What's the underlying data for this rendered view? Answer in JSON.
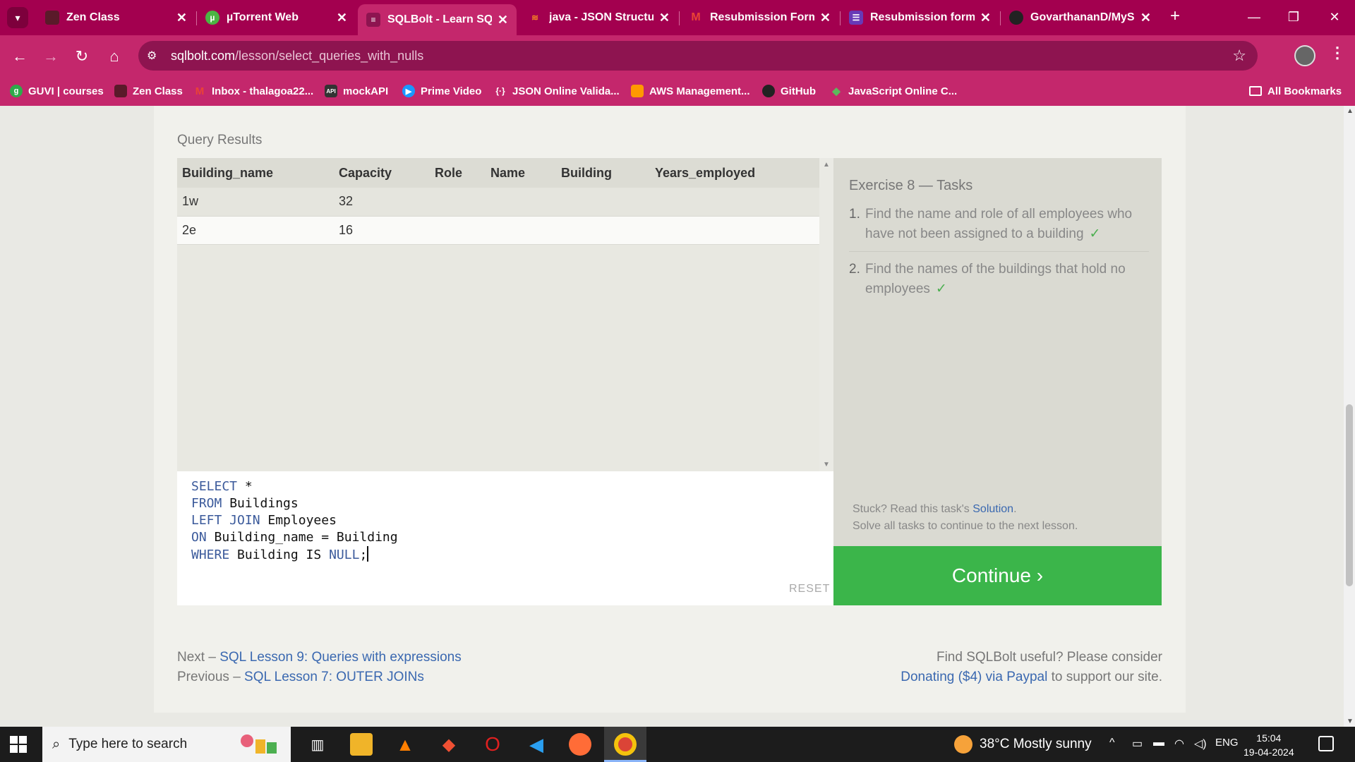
{
  "browser": {
    "tabs": [
      {
        "title": "Zen Class",
        "icon": "zen-class-icon",
        "color": "#5a1a2a"
      },
      {
        "title": "µTorrent Web",
        "icon": "utorrent-icon",
        "color": "#4bb543"
      },
      {
        "title": "SQLBolt - Learn SQL",
        "icon": "sqlbolt-icon",
        "color": "#c4276c"
      },
      {
        "title": "java - JSON Structur",
        "icon": "stackoverflow-icon",
        "color": "#f48024"
      },
      {
        "title": "Resubmission Form",
        "icon": "gmail-icon",
        "color": "#ea4335"
      },
      {
        "title": "Resubmission form",
        "icon": "google-forms-icon",
        "color": "#673ab7"
      },
      {
        "title": "GovarthananD/MySQ",
        "icon": "github-icon",
        "color": "#222222"
      }
    ],
    "url_host": "sqlbolt.com",
    "url_path": "/lesson/select_queries_with_nulls",
    "bookmarks": [
      {
        "label": "GUVI | courses",
        "icon": "guvi-icon",
        "color": "#2eaa4a"
      },
      {
        "label": "Zen Class",
        "icon": "zen-class-icon",
        "color": "#5a1a2a"
      },
      {
        "label": "Inbox - thalagoa22...",
        "icon": "gmail-icon",
        "color": "#ea4335"
      },
      {
        "label": "mockAPI",
        "icon": "mockapi-icon",
        "color": "#333333"
      },
      {
        "label": "Prime Video",
        "icon": "prime-video-icon",
        "color": "#1a98ff"
      },
      {
        "label": "JSON Online Valida...",
        "icon": "json-icon",
        "color": "#333333"
      },
      {
        "label": "AWS Management...",
        "icon": "aws-icon",
        "color": "#ff9900"
      },
      {
        "label": "GitHub",
        "icon": "github-icon",
        "color": "#222222"
      },
      {
        "label": "JavaScript Online C...",
        "icon": "js-compiler-icon",
        "color": "#5cb85c"
      }
    ],
    "all_bookmarks": "All Bookmarks"
  },
  "lesson": {
    "results_label": "Query Results",
    "columns": [
      "Building_name",
      "Capacity",
      "Role",
      "Name",
      "Building",
      "Years_employed"
    ],
    "rows": [
      [
        "1w",
        "32",
        "",
        "",
        "",
        ""
      ],
      [
        "2e",
        "16",
        "",
        "",
        "",
        ""
      ]
    ],
    "query_lines": [
      {
        "kw": "SELECT",
        "rest": " *",
        "kw2": "",
        "tail": ""
      },
      {
        "kw": "FROM",
        "rest": " Buildings",
        "kw2": "",
        "tail": ""
      },
      {
        "kw": "LEFT JOIN",
        "rest": " Employees",
        "kw2": "",
        "tail": ""
      },
      {
        "kw": "ON",
        "rest": " Building_name = Building",
        "kw2": "",
        "tail": ""
      },
      {
        "kw": "WHERE",
        "rest": " Building IS ",
        "kw2": "NULL",
        "tail": ";"
      }
    ],
    "reset_label": "RESET",
    "tasks_title": "Exercise 8 — Tasks",
    "tasks": [
      {
        "num": "1.",
        "text": "Find the name and role of all employees who have not been assigned to a building",
        "done": "✓"
      },
      {
        "num": "2.",
        "text": "Find the names of the buildings that hold no employees",
        "done": "✓"
      }
    ],
    "stuck_prefix": "Stuck? Read this task's ",
    "stuck_link": "Solution",
    "stuck_suffix": ".",
    "solve_all": "Solve all tasks to continue to the next lesson.",
    "continue_label": "Continue ›",
    "next_prefix": "Next – ",
    "next_link": "SQL Lesson 9: Queries with expressions",
    "prev_prefix": "Previous – ",
    "prev_link": "SQL Lesson 7: OUTER JOINs",
    "useful_text": "Find SQLBolt useful? Please consider",
    "donate_link": "Donating ($4) via Paypal",
    "donate_suffix": " to support our site."
  },
  "taskbar": {
    "search_placeholder": "Type here to search",
    "weather": "38°C  Mostly sunny",
    "language": "ENG",
    "time": "15:04",
    "date": "19-04-2024"
  },
  "colors": {
    "chrome": "#a3004f",
    "toolbar": "#c4276c",
    "continue": "#3bb54a",
    "link": "#3a68b0"
  }
}
